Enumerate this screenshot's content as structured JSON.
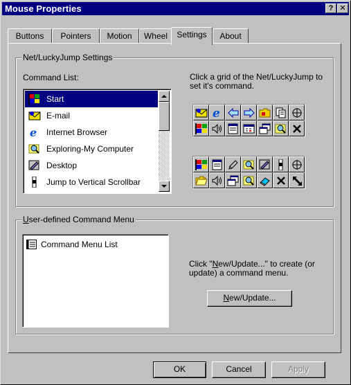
{
  "window": {
    "title": "Mouse Properties",
    "help_label": "?",
    "close_label": "✕"
  },
  "tabs": [
    {
      "label": "Buttons"
    },
    {
      "label": "Pointers"
    },
    {
      "label": "Motion"
    },
    {
      "label": "Wheel"
    },
    {
      "label": "Settings"
    },
    {
      "label": "About"
    }
  ],
  "active_tab": "Settings",
  "netlucky": {
    "group_label": "Net/LuckyJump Settings",
    "command_list_label": "Command List:",
    "instruction": "Click a grid of the Net/LuckyJump to set it's command.",
    "items": [
      {
        "label": "Start",
        "icon": "start-flag-icon"
      },
      {
        "label": "E-mail",
        "icon": "email-icon"
      },
      {
        "label": "Internet Browser",
        "icon": "ie-browser-icon"
      },
      {
        "label": "Exploring-My Computer",
        "icon": "explore-magnifier-icon"
      },
      {
        "label": "Desktop",
        "icon": "desktop-icon"
      },
      {
        "label": "Jump to Vertical Scrollbar",
        "icon": "vertical-scrollbar-icon"
      }
    ],
    "selected_item": "Start",
    "grid1": [
      [
        "email-icon",
        "ie-browser-icon",
        "arrow-left-icon",
        "arrow-right-icon",
        "folder-icon",
        "documents-icon",
        "crosshair-icon"
      ],
      [
        "start-flag-icon",
        "speaker-icon",
        "window-icon",
        "calculator-icon",
        "switch-window-icon",
        "explore-magnifier-icon",
        "close-x-icon"
      ]
    ],
    "grid2": [
      [
        "start-flag-icon",
        "window-icon",
        "pen-icon",
        "explore-magnifier-icon",
        "desktop-icon",
        "vertical-scrollbar-icon",
        "crosshair-icon"
      ],
      [
        "folder-open-icon",
        "speaker-icon",
        "switch-window-icon",
        "explore-magnifier-icon",
        "eraser-icon",
        "close-x-icon",
        "resize-arrow-icon"
      ]
    ]
  },
  "user_defined": {
    "group_label": "User-defined Command Menu",
    "group_label_underline_char": "U",
    "group_label_rest": "ser-defined Command Menu",
    "list_item": "Command Menu List",
    "hint_part1": "Click \"",
    "hint_underline": "N",
    "hint_part2": "ew/Update...\" to create (or update) a command menu.",
    "new_update_underline": "N",
    "new_update_rest": "ew/Update..."
  },
  "buttons": {
    "ok": "OK",
    "cancel": "Cancel",
    "apply": "Apply"
  },
  "colors": {
    "title_bar": "#000080",
    "selection": "#000080",
    "face": "#c0c0c0"
  }
}
